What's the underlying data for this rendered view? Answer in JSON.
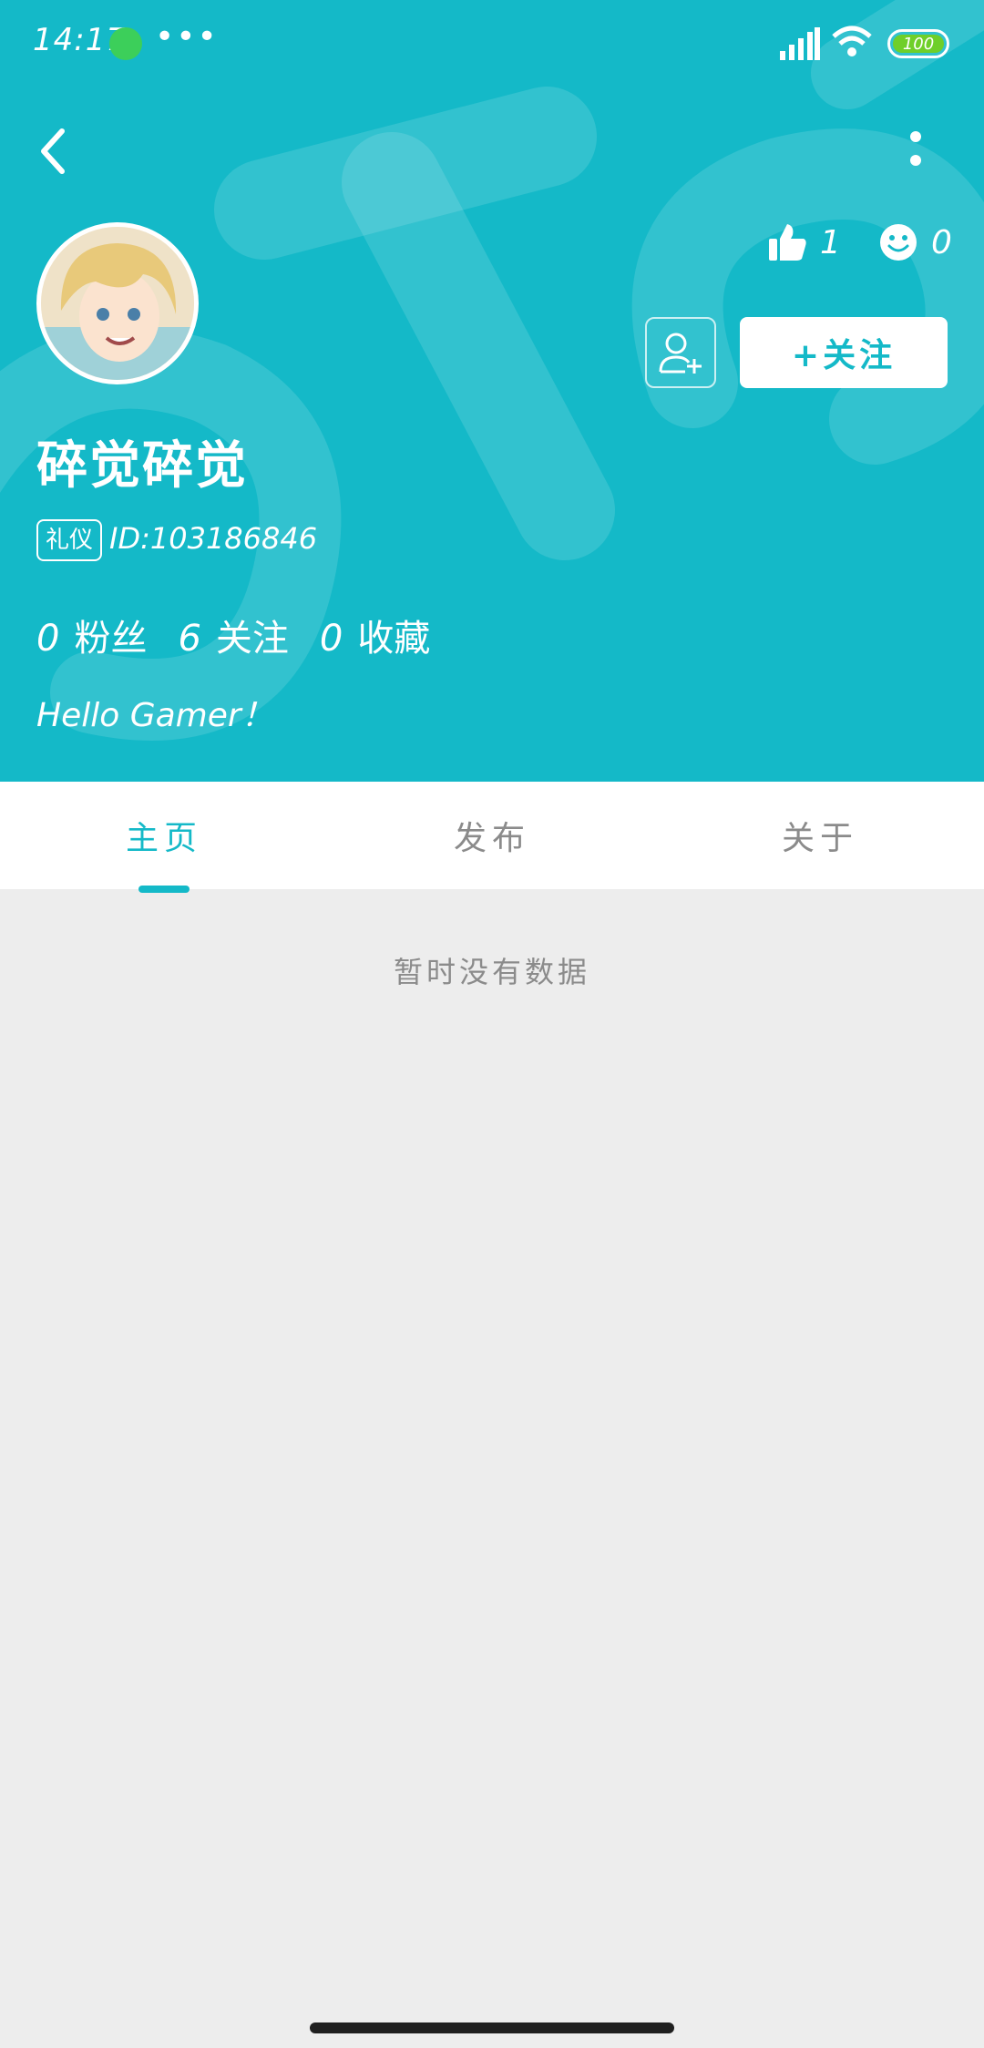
{
  "colors": {
    "accent": "#14b9c8",
    "background": "#ededed",
    "white": "#ffffff",
    "muted_text": "#8b8b8b"
  },
  "status_bar": {
    "time": "14:17",
    "dots": "•••",
    "battery": "100"
  },
  "header": {
    "back_icon": "chevron-left-icon",
    "more_icon": "more-vertical-icon",
    "likes": {
      "icon": "thumbs-up-icon",
      "count": "1"
    },
    "smiles": {
      "icon": "smiley-icon",
      "count": "0"
    },
    "follow_label": "+关注",
    "username": "碎觉碎觉",
    "badge": "礼仪",
    "user_id": "ID:103186846",
    "stats": [
      {
        "value": "0",
        "label": "粉丝"
      },
      {
        "value": "6",
        "label": "关注"
      },
      {
        "value": "0",
        "label": "收藏"
      }
    ],
    "bio": "Hello Gamer！"
  },
  "tabs": [
    {
      "label": "主页",
      "active": true
    },
    {
      "label": "发布",
      "active": false
    },
    {
      "label": "关于",
      "active": false
    }
  ],
  "empty_text": "暂时没有数据"
}
